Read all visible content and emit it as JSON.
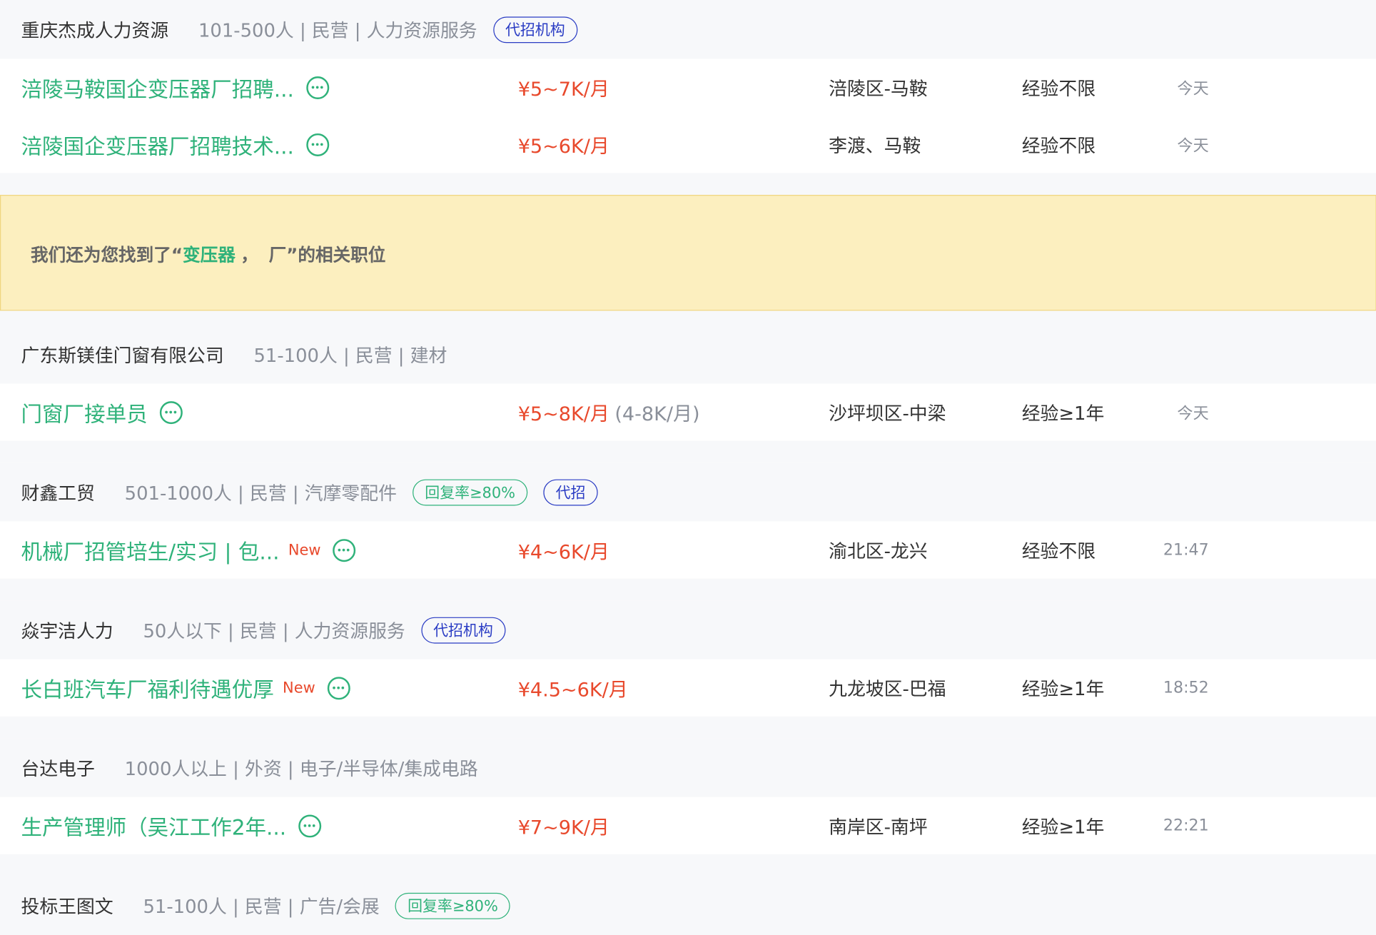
{
  "groups_before": [
    {
      "company": "重庆杰成人力资源",
      "meta": "101-500人 | 民营 | 人力资源服务",
      "tags": [
        {
          "label": "代招机构",
          "color": "blue"
        }
      ],
      "jobs": [
        {
          "title": "涪陵马鞍国企变压器厂招聘...",
          "new": "",
          "salary": "¥5~7K/月",
          "salary_alt": "",
          "location": "涪陵区-马鞍",
          "experience": "经验不限",
          "time": "今天"
        },
        {
          "title": "涪陵国企变压器厂招聘技术...",
          "new": "",
          "salary": "¥5~6K/月",
          "salary_alt": "",
          "location": "李渡、马鞍",
          "experience": "经验不限",
          "time": "今天"
        }
      ]
    }
  ],
  "notice": {
    "prefix": "我们还为您找到了“",
    "keyword1": "变压器",
    "separator": "，",
    "keyword2": "厂",
    "suffix": "”的相关职位"
  },
  "groups": [
    {
      "company": "广东斯镁佳门窗有限公司",
      "meta": "51-100人 | 民营 | 建材",
      "tags": [],
      "jobs": [
        {
          "title": "门窗厂接单员",
          "new": "",
          "salary": "¥5~8K/月",
          "salary_alt": "(4-8K/月)",
          "location": "沙坪坝区-中梁",
          "experience": "经验≥1年",
          "time": "今天"
        }
      ]
    },
    {
      "company": "财鑫工贸",
      "meta": "501-1000人 | 民营 | 汽摩零配件",
      "tags": [
        {
          "label": "回复率≥80%",
          "color": "green"
        },
        {
          "label": "代招",
          "color": "blue"
        }
      ],
      "jobs": [
        {
          "title": "机械厂招管培生/实习 | 包...",
          "new": "New",
          "salary": "¥4~6K/月",
          "salary_alt": "",
          "location": "渝北区-龙兴",
          "experience": "经验不限",
          "time": "21:47"
        }
      ]
    },
    {
      "company": "焱宇洁人力",
      "meta": "50人以下 | 民营 | 人力资源服务",
      "tags": [
        {
          "label": "代招机构",
          "color": "blue"
        }
      ],
      "jobs": [
        {
          "title": "长白班汽车厂福利待遇优厚",
          "new": "New",
          "salary": "¥4.5~6K/月",
          "salary_alt": "",
          "location": "九龙坡区-巴福",
          "experience": "经验≥1年",
          "time": "18:52"
        }
      ]
    },
    {
      "company": "台达电子",
      "meta": "1000人以上 | 外资 | 电子/半导体/集成电路",
      "tags": [],
      "jobs": [
        {
          "title": "生产管理师（吴江工作2年...",
          "new": "",
          "salary": "¥7~9K/月",
          "salary_alt": "",
          "location": "南岸区-南坪",
          "experience": "经验≥1年",
          "time": "22:21"
        }
      ]
    },
    {
      "company": "投标王图文",
      "meta": "51-100人 | 民营 | 广告/会展",
      "tags": [
        {
          "label": "回复率≥80%",
          "color": "green"
        }
      ],
      "jobs": []
    }
  ]
}
